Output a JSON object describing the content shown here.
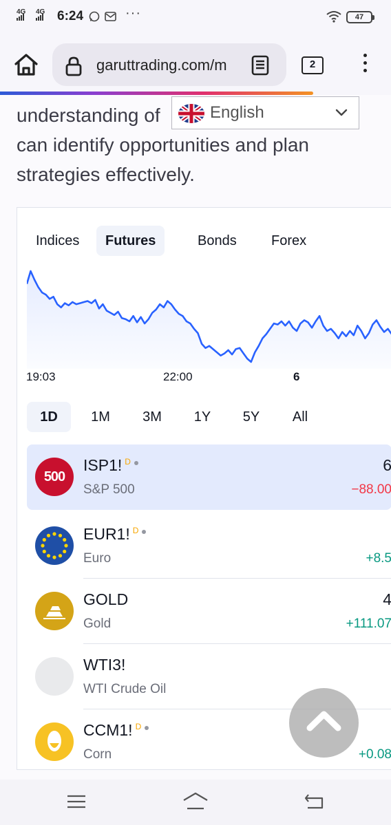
{
  "status_bar": {
    "network_1": "4G",
    "network_2": "4G",
    "time": "6:24",
    "icons": [
      "whatsapp-icon",
      "mail-icon"
    ],
    "more": "···",
    "battery": "47"
  },
  "browser": {
    "url": "garuttrading.com/m",
    "tab_count": "2"
  },
  "page": {
    "paragraph": "understanding of the market, you can identify opportunities and plan strategies effectively.",
    "paragraph_visible_line1": "understanding of",
    "paragraph_visible_line2": "can identify opportunities and plan",
    "paragraph_visible_line3": "strategies effectively.",
    "language_selector": {
      "selected": "English",
      "flag": "uk-flag-icon"
    }
  },
  "widget": {
    "tabs": [
      {
        "label": "Indices",
        "active": false
      },
      {
        "label": "Futures",
        "active": true
      },
      {
        "label": "Bonds",
        "active": false
      },
      {
        "label": "Forex",
        "active": false
      }
    ],
    "chart_data": {
      "type": "area",
      "title": "",
      "xlabel": "",
      "ylabel": "",
      "x_ticks": [
        "19:03",
        "22:00",
        "6"
      ],
      "series": [
        {
          "values": [
            82,
            94,
            86,
            79,
            74,
            72,
            68,
            70,
            63,
            60,
            64,
            62,
            65,
            63,
            64,
            65,
            66,
            64,
            67,
            59,
            63,
            57,
            55,
            53,
            56,
            50,
            49,
            47,
            52,
            46,
            51,
            45,
            49,
            55,
            58,
            63,
            60,
            66,
            63,
            58,
            54,
            52,
            47,
            45,
            40,
            36,
            26,
            22,
            24,
            21,
            18,
            15,
            17,
            20,
            16,
            21,
            22,
            17,
            12,
            9,
            18,
            24,
            31,
            35,
            40,
            45,
            44,
            47,
            43,
            47,
            41,
            38,
            45,
            48,
            46,
            41,
            47,
            52,
            43,
            38,
            40,
            36,
            31,
            37,
            33,
            38,
            34,
            43,
            38,
            31,
            36,
            44,
            48,
            42,
            37,
            40,
            35
          ],
          "color": "#2962ff"
        }
      ]
    },
    "ranges": [
      {
        "label": "1D",
        "active": true
      },
      {
        "label": "1M",
        "active": false
      },
      {
        "label": "3M",
        "active": false
      },
      {
        "label": "1Y",
        "active": false
      },
      {
        "label": "5Y",
        "active": false
      },
      {
        "label": "All",
        "active": false
      }
    ],
    "symbols": [
      {
        "symbol": "ISP1!",
        "delayed": "D",
        "name": "S&P 500",
        "price": "6",
        "change": "−88.00",
        "direction": "neg",
        "logo_text": "500",
        "logo_color": "#c8102e",
        "selected": true
      },
      {
        "symbol": "EUR1!",
        "delayed": "D",
        "name": "Euro",
        "price": "",
        "change": "+8.5",
        "direction": "pos",
        "logo_text": "",
        "logo_color": "#1f4fa6",
        "selected": false
      },
      {
        "symbol": "GOLD",
        "delayed": "",
        "name": "Gold",
        "price": "4",
        "change": "+111.07",
        "direction": "pos",
        "logo_text": "",
        "logo_color": "#d4a417",
        "selected": false
      },
      {
        "symbol": "WTI3!",
        "delayed": "",
        "name": "WTI Crude Oil",
        "price": "",
        "change": "",
        "direction": "",
        "logo_text": "",
        "logo_color": "#e9eaec",
        "selected": false
      },
      {
        "symbol": "CCM1!",
        "delayed": "D",
        "name": "Corn",
        "price": "",
        "change": "+0.08",
        "direction": "pos",
        "logo_text": "",
        "logo_color": "#f7c224",
        "selected": false
      }
    ]
  },
  "colors": {
    "accent": "#2962ff",
    "negative": "#f23645",
    "positive": "#089981",
    "selected_row": "#e3eafd"
  }
}
